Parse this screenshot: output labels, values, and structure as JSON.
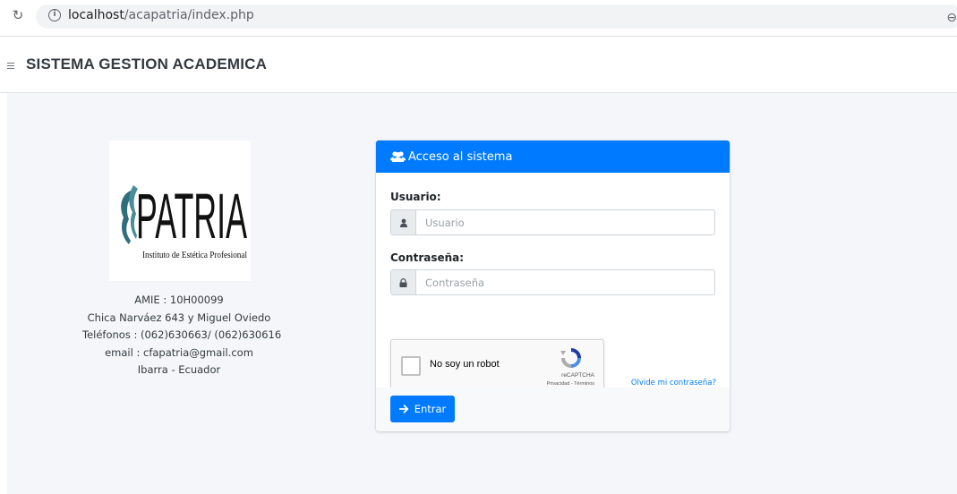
{
  "browser": {
    "url_host": "localhost",
    "url_path": "/acapatria/index.php"
  },
  "app": {
    "title": "SISTEMA GESTION ACADEMICA"
  },
  "logo": {
    "brand_text": "PATRIA",
    "subtitle": "Instituto de Estética Profesional"
  },
  "institution": {
    "amie": "AMIE : 10H00099",
    "address": "Chica Narváez 643 y Miguel Oviedo",
    "phones": "Teléfonos : (062)630663/ (062)630616",
    "email": "email : cfapatria@gmail.com",
    "city": "Ibarra - Ecuador"
  },
  "login": {
    "header_title": "Acceso al sistema",
    "user_label": "Usuario:",
    "user_placeholder": "Usuario",
    "password_label": "Contraseña:",
    "password_placeholder": "Contraseña",
    "captcha_label": "No soy un robot",
    "captcha_brand": "reCAPTCHA",
    "captcha_legal": "Privacidad - Términos",
    "forgot_label": "Olvide mi contraseña?",
    "submit_label": "Entrar"
  },
  "colors": {
    "primary": "#007bff",
    "content_bg": "#f4f6f9",
    "logo_teal": "#2f6f7c"
  },
  "icons": {
    "reload": "reload-icon",
    "info": "info-icon",
    "zoom": "zoom-icon",
    "menu": "hamburger-icon",
    "users": "users-icon",
    "user": "user-icon",
    "lock": "lock-icon",
    "arrow": "arrow-right-icon"
  }
}
